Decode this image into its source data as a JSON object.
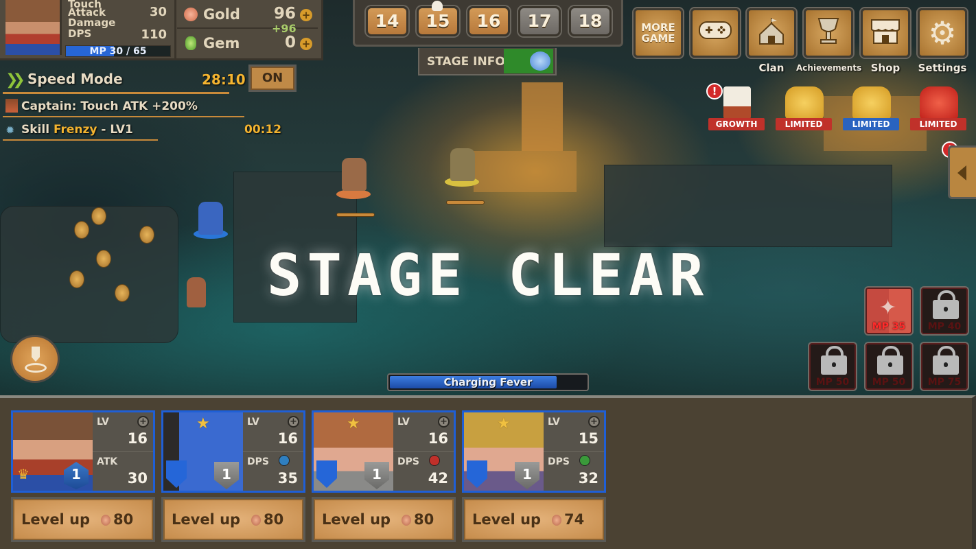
{
  "hero_panel": {
    "stats": [
      {
        "label": "Touch",
        "value": ""
      },
      {
        "label": "Attack",
        "value": "30"
      },
      {
        "label": "Damage",
        "value": ""
      },
      {
        "label": "DPS",
        "value": "110"
      }
    ],
    "mp_text": "MP 30 / 65",
    "mp_current": 30,
    "mp_max": 65
  },
  "resources": {
    "gold": {
      "label": "Gold",
      "value": "96",
      "gain": "+96",
      "add_icon": "+"
    },
    "gem": {
      "label": "Gem",
      "value": "0",
      "add_icon": "+"
    }
  },
  "speed_mode": {
    "icon": "double-chevron-icon",
    "label": "Speed Mode",
    "time": "28:10",
    "toggle_label": "ON"
  },
  "buffs": {
    "captain_text": "Captain: Touch ATK +200%",
    "skill_prefix": "Skill ",
    "skill_name": "Frenzy",
    "skill_suffix": " - LV1",
    "skill_time": "00:12"
  },
  "stages": [
    {
      "number": "14",
      "state": "cleared"
    },
    {
      "number": "15",
      "state": "cleared",
      "boss": true
    },
    {
      "number": "16",
      "state": "cleared"
    },
    {
      "number": "17",
      "state": "locked"
    },
    {
      "number": "18",
      "state": "locked"
    }
  ],
  "stage_info_label": "STAGE INFO",
  "menu": [
    {
      "id": "more-game",
      "label": "",
      "text": "MORE\nGAME",
      "icon": "more-game-icon"
    },
    {
      "id": "games",
      "label": "",
      "icon": "gamepad-icon",
      "glyph": "🎮"
    },
    {
      "id": "clan",
      "label": "Clan",
      "icon": "tent-icon",
      "glyph": "⛺"
    },
    {
      "id": "achievements",
      "label": "Achievements",
      "icon": "trophy-icon",
      "glyph": "🏆"
    },
    {
      "id": "shop",
      "label": "Shop",
      "icon": "shop-icon",
      "glyph": "🏪"
    },
    {
      "id": "settings",
      "label": "Settings",
      "icon": "gear-icon",
      "glyph": "⚙"
    }
  ],
  "events": [
    {
      "label": "GROWTH",
      "ribbon_color": "#c0312a",
      "alert": "!"
    },
    {
      "label": "LIMITED",
      "ribbon_color": "#c0312a"
    },
    {
      "label": "LIMITED",
      "ribbon_color": "#2a63c0"
    },
    {
      "label": "LIMITED",
      "ribbon_color": "#c0312a"
    }
  ],
  "side_toggle_alert": "!",
  "stage_clear_text": "STAGE CLEAR",
  "fever": {
    "label": "Charging Fever",
    "progress": 0.85
  },
  "skills": [
    {
      "cost": "MP 35",
      "locked": false
    },
    {
      "cost": "MP 40",
      "locked": true
    },
    {
      "cost": "MP 50",
      "locked": true
    },
    {
      "cost": "MP 50",
      "locked": true
    },
    {
      "cost": "MP 75",
      "locked": true
    }
  ],
  "heroes": [
    {
      "lv_label": "LV",
      "lv": "16",
      "stat_label": "ATK",
      "stat": "30",
      "rank": "1",
      "element": null,
      "captain": true,
      "levelup_label": "Level up",
      "cost": "80"
    },
    {
      "lv_label": "LV",
      "lv": "16",
      "stat_label": "DPS",
      "stat": "35",
      "rank": "1",
      "element": "water",
      "captain": false,
      "levelup_label": "Level up",
      "cost": "80"
    },
    {
      "lv_label": "LV",
      "lv": "16",
      "stat_label": "DPS",
      "stat": "42",
      "rank": "1",
      "element": "fire",
      "captain": false,
      "levelup_label": "Level up",
      "cost": "80"
    },
    {
      "lv_label": "LV",
      "lv": "15",
      "stat_label": "DPS",
      "stat": "32",
      "rank": "1",
      "element": "wind",
      "captain": false,
      "levelup_label": "Level up",
      "cost": "74"
    }
  ],
  "colors": {
    "accent_gold": "#f4b430",
    "card_border": "#1f5fd6",
    "mp_blue": "#2766d6",
    "element_water": "#2f7fc0",
    "element_fire": "#c0302a",
    "element_wind": "#3a9a3a"
  }
}
